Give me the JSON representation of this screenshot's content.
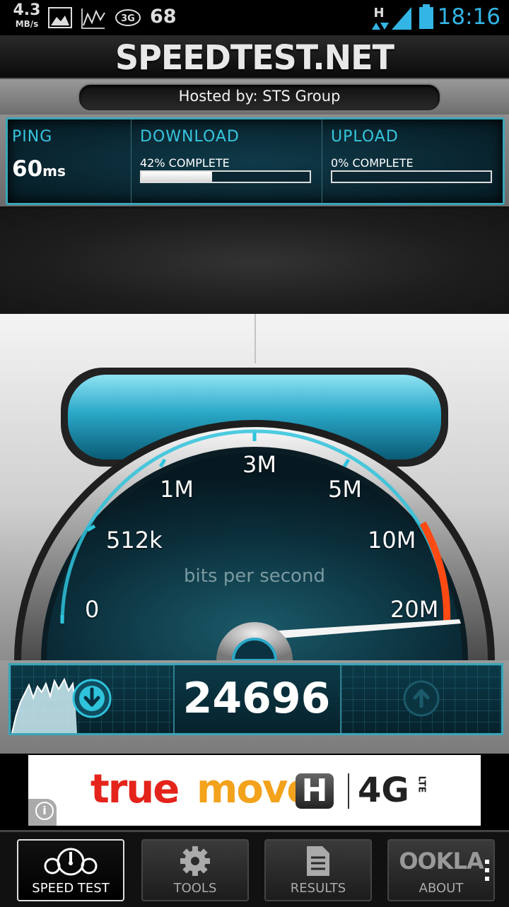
{
  "status_bar": {
    "net_speed": "4.3",
    "net_speed_unit": "MB/s",
    "notification_count": "68",
    "network_type": "H",
    "badge_3g": "3G",
    "time": "18:16"
  },
  "header": {
    "logo_text": "SPEEDTEST.NET"
  },
  "host": {
    "label": "Hosted by: STS Group"
  },
  "stats": {
    "ping_label": "PING",
    "ping_value": "60",
    "ping_unit": "ms",
    "download_label": "DOWNLOAD",
    "download_status": "42% COMPLETE",
    "download_progress": 0.42,
    "upload_label": "UPLOAD",
    "upload_status": "0% COMPLETE",
    "upload_progress": 0
  },
  "gauge": {
    "labels": [
      "0",
      "512k",
      "1M",
      "3M",
      "5M",
      "10M",
      "20M"
    ],
    "unit_label": "bits per second",
    "accent": "#2fc3dc",
    "redline": "#ff3b0f"
  },
  "readout": {
    "speed_value": "24696"
  },
  "ad": {
    "brand_true": "true",
    "brand_move": "move",
    "h_badge": "H",
    "network": "4G",
    "lte": "LTE",
    "info": "i"
  },
  "nav": {
    "items": [
      {
        "label": "SPEED TEST",
        "icon": "speedometer-icon",
        "active": true
      },
      {
        "label": "TOOLS",
        "icon": "gear-icon",
        "active": false
      },
      {
        "label": "RESULTS",
        "icon": "document-icon",
        "active": false
      },
      {
        "label": "ABOUT",
        "icon": "ookla-logo",
        "active": false,
        "logo_text": "OOKLA"
      }
    ]
  }
}
